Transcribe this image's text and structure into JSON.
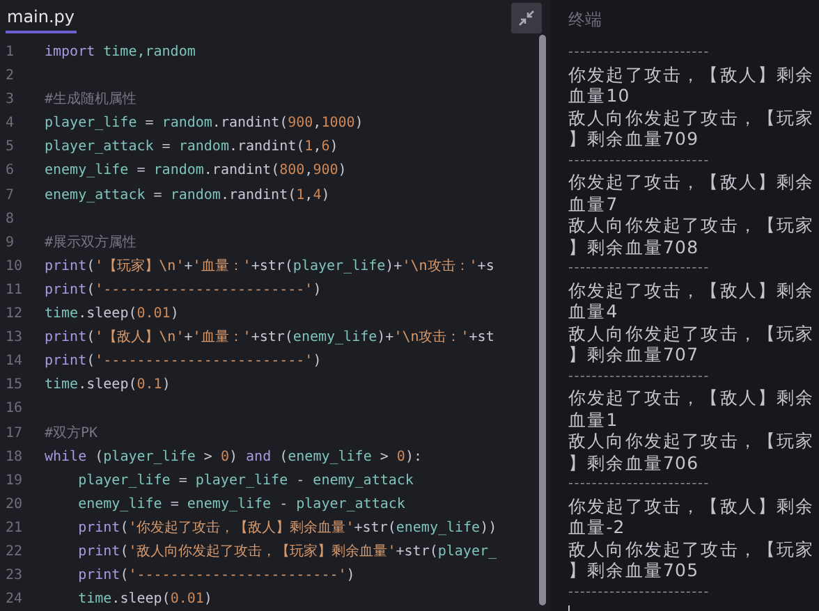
{
  "editor": {
    "tab": {
      "label": "main.py",
      "selected": true
    },
    "lines": [
      {
        "number": "1",
        "tokens": [
          {
            "kind": "keyword",
            "text": "import"
          },
          {
            "kind": "name",
            "text": " time,random"
          }
        ]
      },
      {
        "number": "2"
      },
      {
        "number": "3",
        "tokens": [
          {
            "kind": "comment",
            "text": "#生成随机属性"
          }
        ]
      },
      {
        "number": "4",
        "tokens": [
          {
            "kind": "name",
            "text": "player_life"
          },
          {
            "kind": "plain",
            "text": " = "
          },
          {
            "kind": "name",
            "text": "random"
          },
          {
            "kind": "plain",
            "text": ".randint("
          },
          {
            "kind": "number",
            "text": "900"
          },
          {
            "kind": "plain",
            "text": ","
          },
          {
            "kind": "number",
            "text": "1000"
          },
          {
            "kind": "plain",
            "text": ")"
          }
        ]
      },
      {
        "number": "5",
        "tokens": [
          {
            "kind": "name",
            "text": "player_attack"
          },
          {
            "kind": "plain",
            "text": " = "
          },
          {
            "kind": "name",
            "text": "random"
          },
          {
            "kind": "plain",
            "text": ".randint("
          },
          {
            "kind": "number",
            "text": "1"
          },
          {
            "kind": "plain",
            "text": ","
          },
          {
            "kind": "number",
            "text": "6"
          },
          {
            "kind": "plain",
            "text": ")"
          }
        ]
      },
      {
        "number": "6",
        "tokens": [
          {
            "kind": "name",
            "text": "enemy_life"
          },
          {
            "kind": "plain",
            "text": " = "
          },
          {
            "kind": "name",
            "text": "random"
          },
          {
            "kind": "plain",
            "text": ".randint("
          },
          {
            "kind": "number",
            "text": "800"
          },
          {
            "kind": "plain",
            "text": ","
          },
          {
            "kind": "number",
            "text": "900"
          },
          {
            "kind": "plain",
            "text": ")"
          }
        ]
      },
      {
        "number": "7",
        "tokens": [
          {
            "kind": "name",
            "text": "enemy_attack"
          },
          {
            "kind": "plain",
            "text": " = "
          },
          {
            "kind": "name",
            "text": "random"
          },
          {
            "kind": "plain",
            "text": ".randint("
          },
          {
            "kind": "number",
            "text": "1"
          },
          {
            "kind": "plain",
            "text": ","
          },
          {
            "kind": "number",
            "text": "4"
          },
          {
            "kind": "plain",
            "text": ")"
          }
        ]
      },
      {
        "number": "8"
      },
      {
        "number": "9",
        "tokens": [
          {
            "kind": "comment",
            "text": "#展示双方属性"
          }
        ]
      },
      {
        "number": "10",
        "tokens": [
          {
            "kind": "keyword",
            "text": "print"
          },
          {
            "kind": "plain",
            "text": "("
          },
          {
            "kind": "string",
            "text": "'【玩家】\\n'"
          },
          {
            "kind": "plain",
            "text": "+"
          },
          {
            "kind": "string",
            "text": "'血量：'"
          },
          {
            "kind": "plain",
            "text": "+str("
          },
          {
            "kind": "name",
            "text": "player_life"
          },
          {
            "kind": "plain",
            "text": ")+"
          },
          {
            "kind": "string",
            "text": "'\\n攻击：'"
          },
          {
            "kind": "plain",
            "text": "+s"
          }
        ]
      },
      {
        "number": "11",
        "tokens": [
          {
            "kind": "keyword",
            "text": "print"
          },
          {
            "kind": "plain",
            "text": "("
          },
          {
            "kind": "string",
            "text": "'------------------------'"
          },
          {
            "kind": "plain",
            "text": ")"
          }
        ]
      },
      {
        "number": "12",
        "tokens": [
          {
            "kind": "name",
            "text": "time"
          },
          {
            "kind": "plain",
            "text": ".sleep("
          },
          {
            "kind": "number",
            "text": "0.01"
          },
          {
            "kind": "plain",
            "text": ")"
          }
        ]
      },
      {
        "number": "13",
        "tokens": [
          {
            "kind": "keyword",
            "text": "print"
          },
          {
            "kind": "plain",
            "text": "("
          },
          {
            "kind": "string",
            "text": "'【敌人】\\n'"
          },
          {
            "kind": "plain",
            "text": "+"
          },
          {
            "kind": "string",
            "text": "'血量：'"
          },
          {
            "kind": "plain",
            "text": "+str("
          },
          {
            "kind": "name",
            "text": "enemy_life"
          },
          {
            "kind": "plain",
            "text": ")+"
          },
          {
            "kind": "string",
            "text": "'\\n攻击：'"
          },
          {
            "kind": "plain",
            "text": "+st"
          }
        ]
      },
      {
        "number": "14",
        "tokens": [
          {
            "kind": "keyword",
            "text": "print"
          },
          {
            "kind": "plain",
            "text": "("
          },
          {
            "kind": "string",
            "text": "'------------------------'"
          },
          {
            "kind": "plain",
            "text": ")"
          }
        ]
      },
      {
        "number": "15",
        "tokens": [
          {
            "kind": "name",
            "text": "time"
          },
          {
            "kind": "plain",
            "text": ".sleep("
          },
          {
            "kind": "number",
            "text": "0.1"
          },
          {
            "kind": "plain",
            "text": ")"
          }
        ]
      },
      {
        "number": "16"
      },
      {
        "number": "17",
        "tokens": [
          {
            "kind": "comment",
            "text": "#双方PK"
          }
        ]
      },
      {
        "number": "18",
        "tokens": [
          {
            "kind": "keyword",
            "text": "while"
          },
          {
            "kind": "plain",
            "text": " ("
          },
          {
            "kind": "name",
            "text": "player_life"
          },
          {
            "kind": "plain",
            "text": " > "
          },
          {
            "kind": "number",
            "text": "0"
          },
          {
            "kind": "plain",
            "text": ") "
          },
          {
            "kind": "keyword",
            "text": "and"
          },
          {
            "kind": "plain",
            "text": " ("
          },
          {
            "kind": "name",
            "text": "enemy_life"
          },
          {
            "kind": "plain",
            "text": " > "
          },
          {
            "kind": "number",
            "text": "0"
          },
          {
            "kind": "plain",
            "text": "):"
          }
        ]
      },
      {
        "number": "19",
        "indented": true,
        "tokens": [
          {
            "kind": "name",
            "text": "player_life"
          },
          {
            "kind": "plain",
            "text": " = "
          },
          {
            "kind": "name",
            "text": "player_life"
          },
          {
            "kind": "plain",
            "text": " - "
          },
          {
            "kind": "name",
            "text": "enemy_attack"
          }
        ]
      },
      {
        "number": "20",
        "indented": true,
        "tokens": [
          {
            "kind": "name",
            "text": "enemy_life"
          },
          {
            "kind": "plain",
            "text": " = "
          },
          {
            "kind": "name",
            "text": "enemy_life"
          },
          {
            "kind": "plain",
            "text": " - "
          },
          {
            "kind": "name",
            "text": "player_attack"
          }
        ]
      },
      {
        "number": "21",
        "indented": true,
        "tokens": [
          {
            "kind": "keyword",
            "text": "print"
          },
          {
            "kind": "plain",
            "text": "("
          },
          {
            "kind": "string",
            "text": "'你发起了攻击，【敌人】剩余血量'"
          },
          {
            "kind": "plain",
            "text": "+str("
          },
          {
            "kind": "name",
            "text": "enemy_life"
          },
          {
            "kind": "plain",
            "text": "))"
          }
        ]
      },
      {
        "number": "22",
        "indented": true,
        "tokens": [
          {
            "kind": "keyword",
            "text": "print"
          },
          {
            "kind": "plain",
            "text": "("
          },
          {
            "kind": "string",
            "text": "'敌人向你发起了攻击，【玩家】剩余血量'"
          },
          {
            "kind": "plain",
            "text": "+str("
          },
          {
            "kind": "name",
            "text": "player_"
          }
        ]
      },
      {
        "number": "23",
        "indented": true,
        "tokens": [
          {
            "kind": "keyword",
            "text": "print"
          },
          {
            "kind": "plain",
            "text": "("
          },
          {
            "kind": "string",
            "text": "'------------------------'"
          },
          {
            "kind": "plain",
            "text": ")"
          }
        ]
      },
      {
        "number": "24",
        "indented": true,
        "tokens": [
          {
            "kind": "name",
            "text": "time"
          },
          {
            "kind": "plain",
            "text": ".sleep("
          },
          {
            "kind": "number",
            "text": "0.01"
          },
          {
            "kind": "plain",
            "text": ")"
          }
        ]
      }
    ]
  },
  "terminal": {
    "title": "终端",
    "lines": [
      {
        "kind": "separator",
        "text": "------------------------"
      },
      {
        "kind": "output",
        "text": "你发起了攻击，【敌人】剩余"
      },
      {
        "kind": "output",
        "text": "血量10"
      },
      {
        "kind": "output",
        "text": "敌人向你发起了攻击，【玩家"
      },
      {
        "kind": "output",
        "text": "】剩余血量709"
      },
      {
        "kind": "separator",
        "text": "------------------------"
      },
      {
        "kind": "output",
        "text": "你发起了攻击，【敌人】剩余"
      },
      {
        "kind": "output",
        "text": "血量7"
      },
      {
        "kind": "output",
        "text": "敌人向你发起了攻击，【玩家"
      },
      {
        "kind": "output",
        "text": "】剩余血量708"
      },
      {
        "kind": "separator",
        "text": "------------------------"
      },
      {
        "kind": "output",
        "text": "你发起了攻击，【敌人】剩余"
      },
      {
        "kind": "output",
        "text": "血量4"
      },
      {
        "kind": "output",
        "text": "敌人向你发起了攻击，【玩家"
      },
      {
        "kind": "output",
        "text": "】剩余血量707"
      },
      {
        "kind": "separator",
        "text": "------------------------"
      },
      {
        "kind": "output",
        "text": "你发起了攻击，【敌人】剩余"
      },
      {
        "kind": "output",
        "text": "血量1"
      },
      {
        "kind": "output",
        "text": "敌人向你发起了攻击，【玩家"
      },
      {
        "kind": "output",
        "text": "】剩余血量706"
      },
      {
        "kind": "separator",
        "text": "------------------------"
      },
      {
        "kind": "output",
        "text": "你发起了攻击，【敌人】剩余"
      },
      {
        "kind": "output",
        "text": "血量-2"
      },
      {
        "kind": "output",
        "text": "敌人向你发起了攻击，【玩家"
      },
      {
        "kind": "output",
        "text": "】剩余血量705"
      },
      {
        "kind": "separator",
        "text": "------------------------"
      }
    ]
  }
}
